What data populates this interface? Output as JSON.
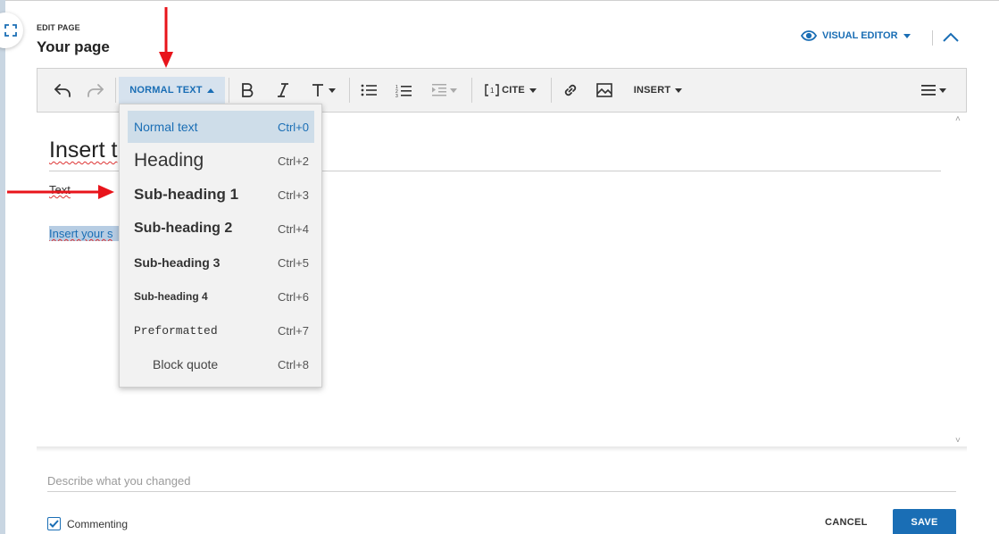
{
  "header": {
    "edit_label": "EDIT PAGE",
    "title": "Your page",
    "visual_editor_label": "VISUAL EDITOR"
  },
  "toolbar": {
    "paragraph_format_label": "NORMAL TEXT",
    "cite_label": "CITE",
    "insert_label": "INSERT"
  },
  "dropdown": {
    "items": [
      {
        "label": "Normal text",
        "shortcut": "Ctrl+0"
      },
      {
        "label": "Heading",
        "shortcut": "Ctrl+2"
      },
      {
        "label": "Sub-heading 1",
        "shortcut": "Ctrl+3"
      },
      {
        "label": "Sub-heading 2",
        "shortcut": "Ctrl+4"
      },
      {
        "label": "Sub-heading 3",
        "shortcut": "Ctrl+5"
      },
      {
        "label": "Sub-heading 4",
        "shortcut": "Ctrl+6"
      },
      {
        "label": "Preformatted",
        "shortcut": "Ctrl+7"
      },
      {
        "label": "Block quote",
        "shortcut": "Ctrl+8"
      }
    ]
  },
  "document": {
    "heading": "Insert t",
    "text": "Text",
    "selected_text": "Insert your s"
  },
  "footer": {
    "summary_placeholder": "Describe what you changed",
    "commenting_label": "Commenting",
    "commenting_checked": true,
    "cancel_label": "CANCEL",
    "save_label": "SAVE"
  },
  "colors": {
    "accent": "#1a6eb5",
    "annotation_arrow": "#e8141b"
  }
}
